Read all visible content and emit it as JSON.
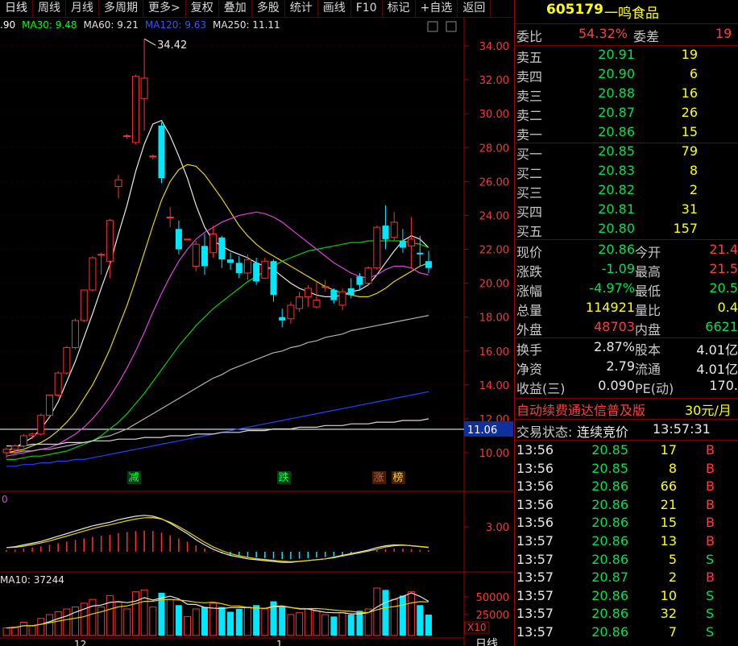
{
  "toolbar": [
    "日线",
    "周线",
    "月线",
    "多周期",
    "更多>",
    "复权",
    "叠加",
    "多股",
    "统计",
    "画线",
    "F10",
    "标记",
    "+自选",
    "返回"
  ],
  "ma_legend": [
    {
      "text": ".90",
      "color": "#ffffff"
    },
    {
      "text": "MA30: 9.48",
      "color": "#00ff00"
    },
    {
      "text": "MA60: 9.21",
      "color": "#e0e0e0"
    },
    {
      "text": "MA120: 9.63",
      "color": "#3355ff"
    },
    {
      "text": "MA250: 11.11",
      "color": "#e0e0e0"
    }
  ],
  "price_axis": [
    "34.00",
    "32.00",
    "30.00",
    "28.00",
    "26.00",
    "24.00",
    "22.00",
    "20.00",
    "18.00",
    "16.00",
    "14.00",
    "12.00",
    "10.00"
  ],
  "current_tag": "11.06",
  "high_label": "34.42",
  "markers": [
    {
      "text": "减",
      "color": "#00ff50"
    },
    {
      "text": "跌",
      "color": "#00ff50"
    },
    {
      "text": "涨",
      "color": "#ff4040"
    },
    {
      "text": "榜",
      "color": "#ffcc33"
    }
  ],
  "macd_label": "0",
  "macd_axis": "3.00",
  "vol_label": "MA10: 37244",
  "vol_axis": [
    "50000",
    "25000"
  ],
  "vol_unit": "X10",
  "x_labels": [
    "12",
    "1"
  ],
  "bottom_right": "日线",
  "stock": {
    "code": "605179",
    "name": "一鸣食品"
  },
  "weibi": {
    "label": "委比",
    "value": "54.32%",
    "label2": "委差",
    "value2": "19"
  },
  "sell": [
    {
      "label": "卖五",
      "price": "20.91",
      "vol": "19"
    },
    {
      "label": "卖四",
      "price": "20.90",
      "vol": "6"
    },
    {
      "label": "卖三",
      "price": "20.88",
      "vol": "16"
    },
    {
      "label": "卖二",
      "price": "20.87",
      "vol": "26"
    },
    {
      "label": "卖一",
      "price": "20.86",
      "vol": "15"
    }
  ],
  "buy": [
    {
      "label": "买一",
      "price": "20.85",
      "vol": "79"
    },
    {
      "label": "买二",
      "price": "20.83",
      "vol": "8"
    },
    {
      "label": "买三",
      "price": "20.82",
      "vol": "2"
    },
    {
      "label": "买四",
      "price": "20.81",
      "vol": "31"
    },
    {
      "label": "买五",
      "price": "20.80",
      "vol": "157"
    }
  ],
  "quote": [
    {
      "l1": "现价",
      "v1": "20.86",
      "c1": "green",
      "l2": "今开",
      "v2": "21.4",
      "c2": "red"
    },
    {
      "l1": "涨跌",
      "v1": "-1.09",
      "c1": "green",
      "l2": "最高",
      "v2": "21.5",
      "c2": "red"
    },
    {
      "l1": "涨幅",
      "v1": "-4.97%",
      "c1": "green",
      "l2": "最低",
      "v2": "20.5",
      "c2": "green"
    },
    {
      "l1": "总量",
      "v1": "114921",
      "c1": "yellow",
      "l2": "量比",
      "v2": "0.4",
      "c2": "yellow"
    },
    {
      "l1": "外盘",
      "v1": "48703",
      "c1": "red",
      "l2": "内盘",
      "v2": "6621",
      "c2": "green"
    }
  ],
  "fin": [
    {
      "l1": "换手",
      "v1": "2.87%",
      "l2": "股本",
      "v2": "4.01亿"
    },
    {
      "l1": "净资",
      "v1": "2.79",
      "l2": "流通",
      "v2": "4.01亿"
    },
    {
      "l1": "收益(三)",
      "v1": "0.090",
      "l2": "PE(动)",
      "v2": "170."
    }
  ],
  "ad": {
    "text": "自动续费通达信普及版",
    "price": "30元/月"
  },
  "trade_status": {
    "label": "交易状态:",
    "value": "连续竞价",
    "time": "13:57:31"
  },
  "ticks": [
    {
      "t": "13:56",
      "p": "20.85",
      "v": "17",
      "s": "B"
    },
    {
      "t": "13:56",
      "p": "20.85",
      "v": "8",
      "s": "B"
    },
    {
      "t": "13:56",
      "p": "20.86",
      "v": "66",
      "s": "B"
    },
    {
      "t": "13:56",
      "p": "20.86",
      "v": "21",
      "s": "B"
    },
    {
      "t": "13:56",
      "p": "20.86",
      "v": "15",
      "s": "B"
    },
    {
      "t": "13:57",
      "p": "20.86",
      "v": "13",
      "s": "B"
    },
    {
      "t": "13:57",
      "p": "20.86",
      "v": "5",
      "s": "S"
    },
    {
      "t": "13:57",
      "p": "20.87",
      "v": "2",
      "s": "B"
    },
    {
      "t": "13:57",
      "p": "20.86",
      "v": "10",
      "s": "S"
    },
    {
      "t": "13:57",
      "p": "20.86",
      "v": "32",
      "s": "S"
    },
    {
      "t": "13:57",
      "p": "20.86",
      "v": "7",
      "s": "S"
    }
  ],
  "candles": [
    [
      10.0,
      10.3,
      9.7,
      10.2
    ],
    [
      10.2,
      10.5,
      10.0,
      10.4
    ],
    [
      10.4,
      11.1,
      10.3,
      11.0
    ],
    [
      11.0,
      11.2,
      10.8,
      11.1
    ],
    [
      11.1,
      12.3,
      11.0,
      12.2
    ],
    [
      12.2,
      13.4,
      12.1,
      13.4
    ],
    [
      13.4,
      14.8,
      13.3,
      14.7
    ],
    [
      14.7,
      16.3,
      14.6,
      16.2
    ],
    [
      16.2,
      17.9,
      16.1,
      17.8
    ],
    [
      17.8,
      19.6,
      17.7,
      19.6
    ],
    [
      19.6,
      21.6,
      19.5,
      21.5
    ],
    [
      21.7,
      21.8,
      20.5,
      21.7
    ],
    [
      21.3,
      23.8,
      20.3,
      23.7
    ],
    [
      25.7,
      26.4,
      25.0,
      26.1
    ],
    [
      28.7,
      28.8,
      28.5,
      28.7
    ],
    [
      28.3,
      32.3,
      28.2,
      32.2
    ],
    [
      30.9,
      34.4,
      29.0,
      32.1
    ],
    [
      27.5,
      27.6,
      27.3,
      27.5
    ],
    [
      29.3,
      29.5,
      25.9,
      26.2
    ],
    [
      23.9,
      24.5,
      23.3,
      23.9
    ],
    [
      23.2,
      23.7,
      21.7,
      22.0
    ],
    [
      22.6,
      22.6,
      22.6,
      22.6
    ],
    [
      21.0,
      22.5,
      20.7,
      22.3
    ],
    [
      22.2,
      22.9,
      20.5,
      21.0
    ],
    [
      21.8,
      23.4,
      21.5,
      22.9
    ],
    [
      22.7,
      22.8,
      20.9,
      21.4
    ],
    [
      21.4,
      21.8,
      20.8,
      21.2
    ],
    [
      21.2,
      21.6,
      20.3,
      20.6
    ],
    [
      20.6,
      21.7,
      20.2,
      21.4
    ],
    [
      21.2,
      21.5,
      19.9,
      20.1
    ],
    [
      20.3,
      21.5,
      20.3,
      21.3
    ],
    [
      21.3,
      21.4,
      18.9,
      19.3
    ],
    [
      18.0,
      18.5,
      17.4,
      17.8
    ],
    [
      17.9,
      18.9,
      17.6,
      18.7
    ],
    [
      18.5,
      19.5,
      18.3,
      19.2
    ],
    [
      19.2,
      19.9,
      18.6,
      19.7
    ],
    [
      18.6,
      20.1,
      18.5,
      19.0
    ],
    [
      19.8,
      20.2,
      19.5,
      19.8
    ],
    [
      19.6,
      19.7,
      18.8,
      19.0
    ],
    [
      18.7,
      19.7,
      18.4,
      19.5
    ],
    [
      19.7,
      20.3,
      19.1,
      19.3
    ],
    [
      20.4,
      20.6,
      19.6,
      19.9
    ],
    [
      20.0,
      21.0,
      19.9,
      20.9
    ],
    [
      20.9,
      23.4,
      20.8,
      23.3
    ],
    [
      23.4,
      24.6,
      22.0,
      22.6
    ],
    [
      22.7,
      24.2,
      22.5,
      23.6
    ],
    [
      22.5,
      23.2,
      21.8,
      22.1
    ],
    [
      22.2,
      23.9,
      20.9,
      22.6
    ],
    [
      21.8,
      22.8,
      21.0,
      21.7
    ],
    [
      21.3,
      21.9,
      20.6,
      20.9
    ]
  ],
  "ma_lines": {
    "white": [
      10.1,
      10.3,
      10.6,
      10.9,
      11.4,
      12.1,
      13.0,
      14.2,
      15.4,
      16.8,
      18.2,
      19.7,
      21.1,
      22.9,
      24.6,
      26.6,
      28.2,
      29.4,
      29.6,
      28.7,
      27.5,
      26.2,
      24.6,
      23.3,
      22.5,
      22.2,
      21.9,
      21.7,
      21.5,
      21.2,
      21.0,
      20.8,
      20.4,
      20.0,
      19.7,
      19.5,
      19.3,
      19.2,
      19.2,
      19.3,
      19.5,
      19.6,
      19.9,
      20.5,
      21.2,
      21.9,
      22.5,
      22.8,
      22.6,
      22.1
    ],
    "yellow": [
      10.0,
      10.1,
      10.2,
      10.4,
      10.6,
      10.9,
      11.3,
      11.8,
      12.4,
      13.2,
      14.0,
      15.0,
      16.1,
      17.4,
      18.7,
      20.2,
      21.8,
      23.4,
      24.9,
      26.0,
      26.7,
      27.0,
      26.9,
      26.4,
      25.7,
      25.0,
      24.2,
      23.4,
      22.8,
      22.3,
      21.9,
      21.6,
      21.3,
      21.0,
      20.7,
      20.4,
      20.1,
      19.8,
      19.6,
      19.4,
      19.3,
      19.2,
      19.2,
      19.4,
      19.7,
      20.1,
      20.4,
      20.7,
      21.0,
      21.2
    ],
    "magenta": [
      9.8,
      9.9,
      10.0,
      10.1,
      10.2,
      10.3,
      10.5,
      10.8,
      11.1,
      11.5,
      12.0,
      12.6,
      13.3,
      14.1,
      15.0,
      16.0,
      17.1,
      18.3,
      19.4,
      20.4,
      21.3,
      22.0,
      22.6,
      23.0,
      23.3,
      23.6,
      23.8,
      24.0,
      24.1,
      24.2,
      24.1,
      23.9,
      23.6,
      23.2,
      22.8,
      22.4,
      22.0,
      21.6,
      21.2,
      20.9,
      20.6,
      20.4,
      20.3,
      20.5,
      20.8,
      21.0,
      21.0,
      20.9,
      20.6,
      20.5
    ],
    "green": [
      9.6,
      9.6,
      9.7,
      9.8,
      9.8,
      9.9,
      10.0,
      10.1,
      10.3,
      10.5,
      10.7,
      11.0,
      11.4,
      11.8,
      12.3,
      12.9,
      13.5,
      14.2,
      14.9,
      15.6,
      16.3,
      16.9,
      17.5,
      18.0,
      18.5,
      18.9,
      19.3,
      19.7,
      20.1,
      20.4,
      20.7,
      21.0,
      21.3,
      21.5,
      21.7,
      21.9,
      22.0,
      22.1,
      22.2,
      22.3,
      22.4,
      22.4,
      22.5,
      22.5,
      22.5,
      22.5,
      22.5,
      22.4,
      22.3,
      22.1
    ],
    "gray": [
      10.0,
      10.0,
      10.1,
      10.1,
      10.2,
      10.2,
      10.3,
      10.4,
      10.5,
      10.6,
      10.7,
      10.9,
      11.0,
      11.2,
      11.4,
      11.7,
      12.0,
      12.3,
      12.6,
      12.9,
      13.2,
      13.5,
      13.8,
      14.1,
      14.4,
      14.6,
      14.9,
      15.1,
      15.3,
      15.5,
      15.7,
      15.9,
      16.0,
      16.2,
      16.3,
      16.5,
      16.6,
      16.8,
      16.9,
      17.0,
      17.2,
      17.3,
      17.4,
      17.5,
      17.6,
      17.7,
      17.8,
      17.9,
      18.0,
      18.1
    ],
    "blue": [
      9.2,
      9.2,
      9.3,
      9.3,
      9.4,
      9.4,
      9.5,
      9.5,
      9.6,
      9.6,
      9.7,
      9.8,
      9.9,
      10.0,
      10.1,
      10.2,
      10.3,
      10.4,
      10.5,
      10.6,
      10.7,
      10.8,
      10.9,
      11.0,
      11.1,
      11.2,
      11.3,
      11.4,
      11.5,
      11.6,
      11.7,
      11.8,
      11.9,
      12.0,
      12.1,
      12.2,
      12.3,
      12.4,
      12.5,
      12.6,
      12.7,
      12.8,
      12.9,
      13.0,
      13.1,
      13.2,
      13.3,
      13.4,
      13.5,
      13.6
    ],
    "silver": [
      10.4,
      10.4,
      10.4,
      10.5,
      10.5,
      10.5,
      10.5,
      10.6,
      10.6,
      10.6,
      10.7,
      10.7,
      10.7,
      10.8,
      10.8,
      10.8,
      10.9,
      10.9,
      10.9,
      11.0,
      11.0,
      11.0,
      11.1,
      11.1,
      11.1,
      11.2,
      11.2,
      11.2,
      11.3,
      11.3,
      11.3,
      11.4,
      11.4,
      11.4,
      11.5,
      11.5,
      11.5,
      11.6,
      11.6,
      11.6,
      11.7,
      11.7,
      11.7,
      11.8,
      11.8,
      11.8,
      11.9,
      11.9,
      11.9,
      12.0
    ]
  },
  "volumes": [
    8,
    9,
    14,
    10,
    18,
    22,
    25,
    28,
    30,
    34,
    38,
    30,
    42,
    35,
    28,
    46,
    48,
    30,
    45,
    38,
    32,
    20,
    28,
    30,
    34,
    30,
    25,
    28,
    30,
    32,
    28,
    36,
    30,
    22,
    24,
    28,
    26,
    22,
    20,
    24,
    22,
    26,
    28,
    50,
    48,
    38,
    42,
    46,
    32,
    22
  ],
  "macd": [
    0.3,
    0.4,
    0.6,
    0.8,
    1.0,
    1.3,
    1.6,
    1.9,
    2.2,
    2.5,
    2.8,
    3.0,
    3.2,
    3.5,
    3.7,
    3.9,
    4.0,
    3.9,
    3.6,
    3.1,
    2.5,
    1.9,
    1.2,
    0.6,
    0.1,
    -0.3,
    -0.6,
    -0.8,
    -1.0,
    -1.1,
    -1.2,
    -1.3,
    -1.4,
    -1.4,
    -1.3,
    -1.2,
    -1.1,
    -1.0,
    -0.8,
    -0.6,
    -0.4,
    -0.2,
    0.0,
    0.3,
    0.5,
    0.6,
    0.6,
    0.5,
    0.4,
    0.3
  ]
}
